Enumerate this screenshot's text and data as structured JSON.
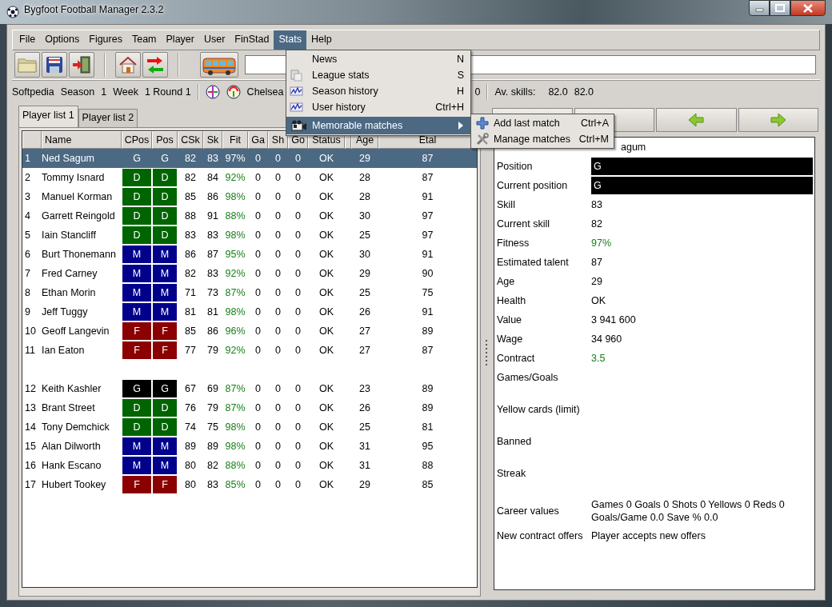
{
  "window": {
    "title": "Bygfoot Football Manager 2.3.2"
  },
  "menubar": [
    {
      "label": "File",
      "selected": false
    },
    {
      "label": "Options",
      "selected": false
    },
    {
      "label": "Figures",
      "selected": false
    },
    {
      "label": "Team",
      "selected": false
    },
    {
      "label": "Player",
      "selected": false
    },
    {
      "label": "User",
      "selected": false
    },
    {
      "label": "FinStad",
      "selected": false
    },
    {
      "label": "Stats",
      "selected": true
    },
    {
      "label": "Help",
      "selected": false
    }
  ],
  "stats_menu": [
    {
      "label": "News",
      "shortcut": "N",
      "selected": false
    },
    {
      "label": "League stats",
      "shortcut": "S",
      "selected": false
    },
    {
      "label": "Season history",
      "shortcut": "H",
      "selected": false
    },
    {
      "label": "User history",
      "shortcut": "Ctrl+H",
      "selected": false
    },
    {
      "label": "Memorable matches",
      "has_submenu": true,
      "selected": true
    }
  ],
  "submenu": [
    {
      "label": "Add last match",
      "shortcut": "Ctrl+A"
    },
    {
      "label": "Manage matches",
      "shortcut": "Ctrl+M"
    }
  ],
  "info": {
    "user": "Softpedia",
    "season_label": "Season",
    "season": "1",
    "week_label": "Week",
    "week": "1 Round 1",
    "team": "Chelsea",
    "partial_value": "0",
    "skills_label": "Av. skills:",
    "skills_1": "82.0",
    "skills_2": "82.0"
  },
  "player_tabs": [
    {
      "label": "Player list 1",
      "selected": true
    },
    {
      "label": "Player list 2",
      "selected": false
    }
  ],
  "table": {
    "columns": [
      "Name",
      "CPos",
      "Pos",
      "CSk",
      "Sk",
      "Fit",
      "Ga",
      "Sh",
      "Go",
      "Status",
      "Age",
      "Etal"
    ],
    "groups": [
      {
        "rows": [
          {
            "selected": true,
            "number": "1",
            "name": "Ned Sagum",
            "cpos": "G",
            "pos": "G",
            "csk": "82",
            "sk": "83",
            "fit": "97%",
            "ga": "0",
            "sh": "0",
            "go": "0",
            "status": "OK",
            "age": "29",
            "etal": "87"
          },
          {
            "selected": false,
            "number": "2",
            "name": "Tommy Isnard",
            "cpos": "D",
            "pos": "D",
            "color": "#006400",
            "csk": "82",
            "sk": "84",
            "fit": "92%",
            "ga": "0",
            "sh": "0",
            "go": "0",
            "status": "OK",
            "age": "28",
            "etal": "87"
          },
          {
            "selected": false,
            "number": "3",
            "name": "Manuel Korman",
            "cpos": "D",
            "pos": "D",
            "color": "#006400",
            "csk": "85",
            "sk": "86",
            "fit": "98%",
            "ga": "0",
            "sh": "0",
            "go": "0",
            "status": "OK",
            "age": "28",
            "etal": "91"
          },
          {
            "selected": false,
            "number": "4",
            "name": "Garrett Reingold",
            "cpos": "D",
            "pos": "D",
            "color": "#006400",
            "csk": "88",
            "sk": "91",
            "fit": "88%",
            "ga": "0",
            "sh": "0",
            "go": "0",
            "status": "OK",
            "age": "30",
            "etal": "97"
          },
          {
            "selected": false,
            "number": "5",
            "name": "Iain Stancliff",
            "cpos": "D",
            "pos": "D",
            "color": "#006400",
            "csk": "83",
            "sk": "83",
            "fit": "98%",
            "ga": "0",
            "sh": "0",
            "go": "0",
            "status": "OK",
            "age": "25",
            "etal": "97"
          },
          {
            "selected": false,
            "number": "6",
            "name": "Burt Thonemann",
            "cpos": "M",
            "pos": "M",
            "color": "#00008b",
            "csk": "86",
            "sk": "87",
            "fit": "95%",
            "ga": "0",
            "sh": "0",
            "go": "0",
            "status": "OK",
            "age": "30",
            "etal": "91"
          },
          {
            "selected": false,
            "number": "7",
            "name": "Fred Carney",
            "cpos": "M",
            "pos": "M",
            "color": "#00008b",
            "csk": "82",
            "sk": "83",
            "fit": "92%",
            "ga": "0",
            "sh": "0",
            "go": "0",
            "status": "OK",
            "age": "29",
            "etal": "90"
          },
          {
            "selected": false,
            "number": "8",
            "name": "Ethan Morin",
            "cpos": "M",
            "pos": "M",
            "color": "#00008b",
            "csk": "71",
            "sk": "73",
            "fit": "87%",
            "ga": "0",
            "sh": "0",
            "go": "0",
            "status": "OK",
            "age": "25",
            "etal": "75"
          },
          {
            "selected": false,
            "number": "9",
            "name": "Jeff Tuggy",
            "cpos": "M",
            "pos": "M",
            "color": "#00008b",
            "csk": "81",
            "sk": "81",
            "fit": "98%",
            "ga": "0",
            "sh": "0",
            "go": "0",
            "status": "OK",
            "age": "26",
            "etal": "91"
          },
          {
            "selected": false,
            "number": "10",
            "name": "Geoff Langevin",
            "cpos": "F",
            "pos": "F",
            "color": "#8b0000",
            "csk": "85",
            "sk": "86",
            "fit": "96%",
            "ga": "0",
            "sh": "0",
            "go": "0",
            "status": "OK",
            "age": "27",
            "etal": "89"
          },
          {
            "selected": false,
            "number": "11",
            "name": "Ian Eaton",
            "cpos": "F",
            "pos": "F",
            "color": "#8b0000",
            "csk": "77",
            "sk": "79",
            "fit": "92%",
            "ga": "0",
            "sh": "0",
            "go": "0",
            "status": "OK",
            "age": "27",
            "etal": "87"
          }
        ]
      },
      {
        "rows": [
          {
            "selected": false,
            "number": "12",
            "name": "Keith Kashler",
            "cpos": "G",
            "pos": "G",
            "color": "#000000",
            "csk": "67",
            "sk": "69",
            "fit": "87%",
            "ga": "0",
            "sh": "0",
            "go": "0",
            "status": "OK",
            "age": "23",
            "etal": "89"
          },
          {
            "selected": false,
            "number": "13",
            "name": "Brant Street",
            "cpos": "D",
            "pos": "D",
            "color": "#006400",
            "csk": "76",
            "sk": "79",
            "fit": "87%",
            "ga": "0",
            "sh": "0",
            "go": "0",
            "status": "OK",
            "age": "26",
            "etal": "89"
          },
          {
            "selected": false,
            "number": "14",
            "name": "Tony Demchick",
            "cpos": "D",
            "pos": "D",
            "color": "#006400",
            "csk": "74",
            "sk": "75",
            "fit": "98%",
            "ga": "0",
            "sh": "0",
            "go": "0",
            "status": "OK",
            "age": "25",
            "etal": "81"
          },
          {
            "selected": false,
            "number": "15",
            "name": "Alan Dilworth",
            "cpos": "M",
            "pos": "M",
            "color": "#00008b",
            "csk": "89",
            "sk": "89",
            "fit": "98%",
            "ga": "0",
            "sh": "0",
            "go": "0",
            "status": "OK",
            "age": "31",
            "etal": "95"
          },
          {
            "selected": false,
            "number": "16",
            "name": "Hank Escano",
            "cpos": "M",
            "pos": "M",
            "color": "#00008b",
            "csk": "80",
            "sk": "82",
            "fit": "88%",
            "ga": "0",
            "sh": "0",
            "go": "0",
            "status": "OK",
            "age": "31",
            "etal": "88"
          },
          {
            "selected": false,
            "number": "17",
            "name": "Hubert Tookey",
            "cpos": "F",
            "pos": "F",
            "color": "#8b0000",
            "csk": "80",
            "sk": "83",
            "fit": "85%",
            "ga": "0",
            "sh": "0",
            "go": "0",
            "status": "OK",
            "age": "29",
            "etal": "85"
          }
        ]
      }
    ]
  },
  "details": {
    "name": "agum",
    "fields": [
      {
        "kind": "bar",
        "label": "Position",
        "value": "G"
      },
      {
        "kind": "bar",
        "label": "Current position",
        "value": "G"
      },
      {
        "kind": "text",
        "label": "Skill",
        "value": "83"
      },
      {
        "kind": "text",
        "label": "Current skill",
        "value": "82"
      },
      {
        "kind": "good",
        "label": "Fitness",
        "value": "97%"
      },
      {
        "kind": "text",
        "label": "Estimated talent",
        "value": "87"
      },
      {
        "kind": "text",
        "label": "Age",
        "value": "29"
      },
      {
        "kind": "text",
        "label": "Health",
        "value": "OK"
      },
      {
        "kind": "text",
        "label": "Value",
        "value": "3 941 600"
      },
      {
        "kind": "text",
        "label": "Wage",
        "value": "34 960"
      },
      {
        "kind": "good",
        "label": "Contract",
        "value": "3.5"
      },
      {
        "kind": "empty",
        "label": "Games/Goals"
      },
      {
        "kind": "empty",
        "label": "Yellow cards (limit)"
      },
      {
        "kind": "empty",
        "label": "Banned"
      },
      {
        "kind": "empty",
        "label": "Streak"
      },
      {
        "kind": "lines",
        "label": "Career values",
        "value_lines": [
          "Games 0 Goals 0 Shots 0 Yellows 0 Reds 0",
          "Goals/Game 0.0 Save % 0.0"
        ]
      },
      {
        "kind": "text",
        "label": "New contract offers",
        "value": "Player accepts new offers"
      }
    ]
  }
}
